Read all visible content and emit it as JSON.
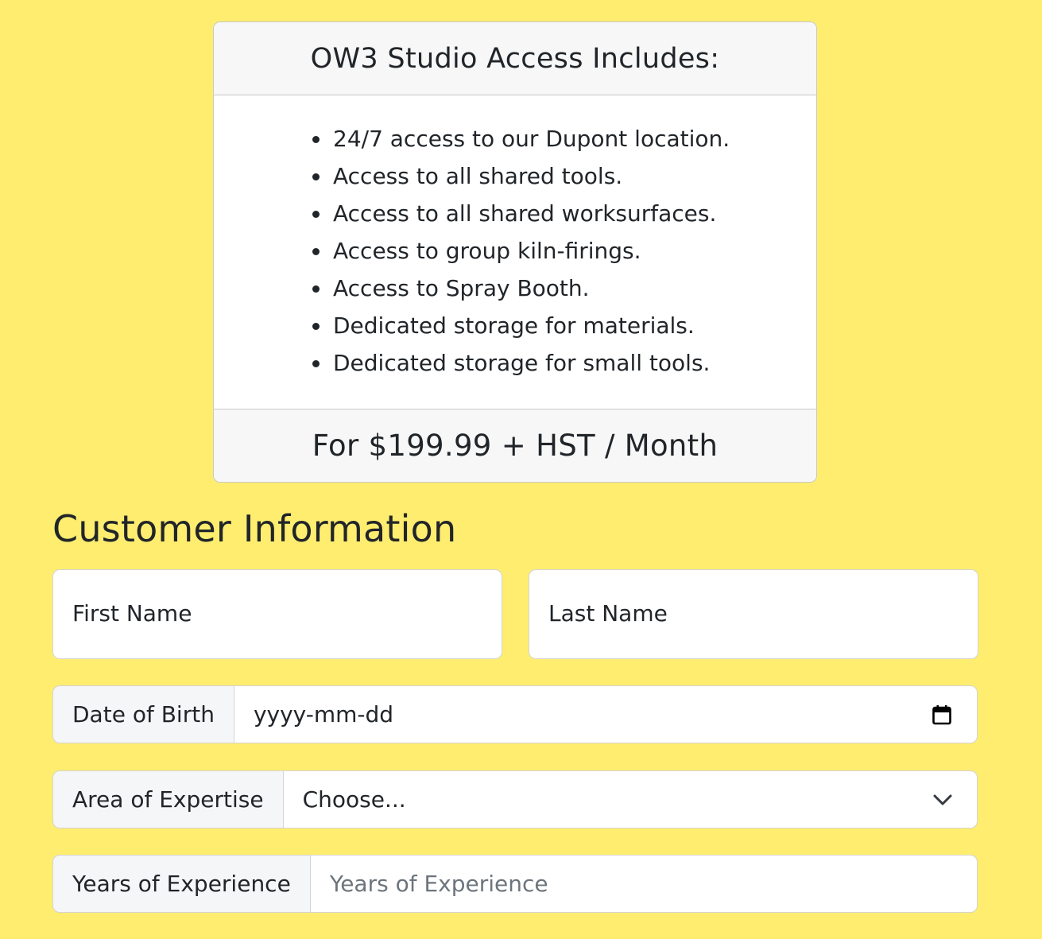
{
  "card": {
    "header": "OW3 Studio Access Includes:",
    "features": [
      "24/7 access to our Dupont location.",
      "Access to all shared tools.",
      "Access to all shared worksurfaces.",
      "Access to group kiln-firings.",
      "Access to Spray Booth.",
      "Dedicated storage for materials.",
      "Dedicated storage for small tools."
    ],
    "footer": "For $199.99 + HST / Month"
  },
  "form": {
    "title": "Customer Information",
    "first_name": {
      "label": "First Name",
      "value": ""
    },
    "last_name": {
      "label": "Last Name",
      "value": ""
    },
    "dob": {
      "label": "Date of Birth",
      "value": "yyyy-mm-dd",
      "icon": "calendar-icon"
    },
    "expertise": {
      "label": "Area of Expertise",
      "selected": "Choose...",
      "icon": "chevron-down-icon"
    },
    "experience": {
      "label": "Years of Experience",
      "placeholder": "Years of Experience"
    }
  },
  "colors": {
    "background": "#ffed6f",
    "card_header_bg": "#f7f7f7",
    "addon_bg": "#f5f6f7",
    "text": "#212529",
    "placeholder": "#6c757d"
  }
}
